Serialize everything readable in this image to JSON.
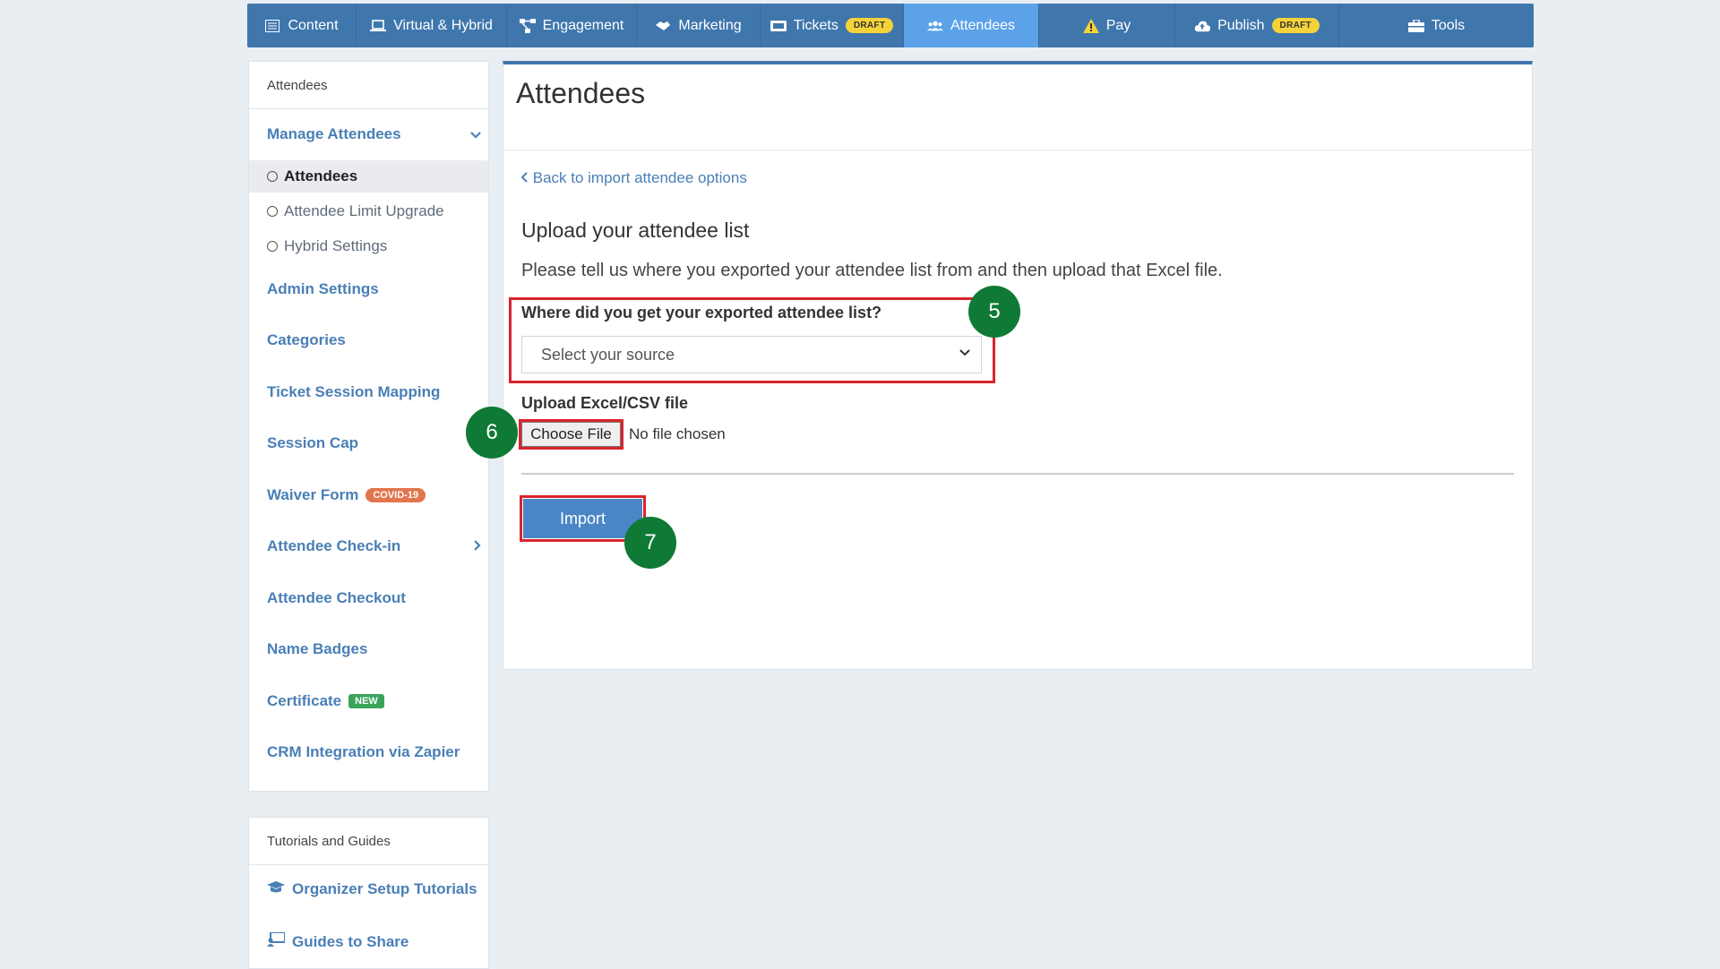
{
  "topnav": {
    "tabs": [
      {
        "label": "Content",
        "icon": "list-icon"
      },
      {
        "label": "Virtual & Hybrid",
        "icon": "laptop-icon"
      },
      {
        "label": "Engagement",
        "icon": "network-icon"
      },
      {
        "label": "Marketing",
        "icon": "handshake-icon"
      },
      {
        "label": "Tickets",
        "icon": "ticket-icon",
        "badge": "DRAFT"
      },
      {
        "label": "Attendees",
        "icon": "users-icon",
        "active": true
      },
      {
        "label": "Pay",
        "icon": "warning-icon"
      },
      {
        "label": "Publish",
        "icon": "cloud-upload-icon",
        "badge": "DRAFT"
      },
      {
        "label": "Tools",
        "icon": "toolbox-icon"
      }
    ]
  },
  "sidebar": {
    "header": "Attendees",
    "manage_label": "Manage Attendees",
    "sub_items": [
      "Attendees",
      "Attendee Limit Upgrade",
      "Hybrid Settings"
    ],
    "items": [
      "Admin Settings",
      "Categories",
      "Ticket Session Mapping",
      "Session Cap",
      "Waiver Form",
      "Attendee Check-in",
      "Attendee Checkout",
      "Name Badges",
      "Certificate",
      "CRM Integration via Zapier"
    ],
    "covid_badge": "COVID-19",
    "new_badge": "NEW"
  },
  "tutorials": {
    "header": "Tutorials and Guides",
    "items": [
      "Organizer Setup Tutorials",
      "Guides to Share"
    ]
  },
  "main": {
    "title": "Attendees",
    "back_link": "Back to import attendee options",
    "section_title": "Upload your attendee list",
    "section_desc": "Please tell us where you exported your attendee list from and then upload that Excel file.",
    "source_label": "Where did you get your exported attendee list?",
    "source_placeholder": "Select your source",
    "upload_label": "Upload Excel/CSV file",
    "choose_file": "Choose File",
    "file_status": "No file chosen",
    "import_button": "Import"
  },
  "steps": [
    "5",
    "6",
    "7"
  ],
  "colors": {
    "nav": "#3f77ad",
    "nav_active": "#5ba2e8",
    "link": "#4a7fb6",
    "highlight": "#d9242b",
    "step": "#0f7a35"
  }
}
